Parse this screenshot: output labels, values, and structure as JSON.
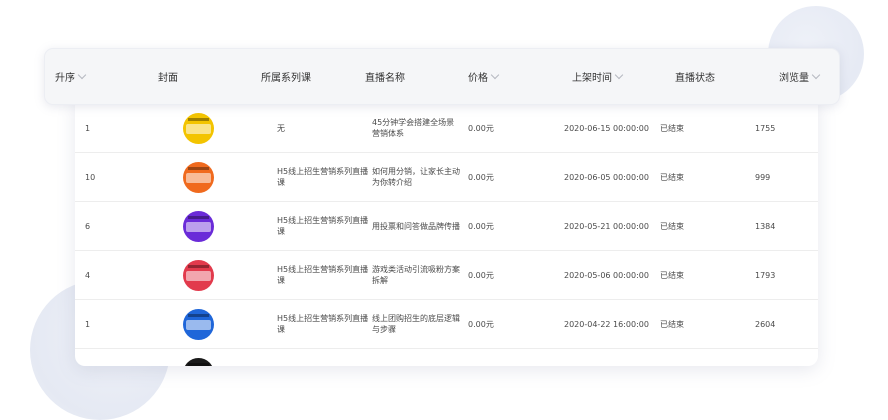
{
  "columns": {
    "seq": "升序",
    "cover": "封面",
    "series": "所属系列课",
    "name": "直播名称",
    "price": "价格",
    "time": "上架时间",
    "status": "直播状态",
    "views": "浏览量"
  },
  "rows": [
    {
      "seq": "1",
      "series": "无",
      "name": "45分钟学会搭建全场景营销体系",
      "price": "0.00元",
      "time": "2020-06-15 00:00:00",
      "status": "已结束",
      "views": "1755",
      "cover_color": "#f3c400"
    },
    {
      "seq": "10",
      "series": "H5线上招生营销系列直播课",
      "name": "如何用分销，让家长主动为你转介绍",
      "price": "0.00元",
      "time": "2020-06-05 00:00:00",
      "status": "已结束",
      "views": "999",
      "cover_color": "#f06a1e"
    },
    {
      "seq": "6",
      "series": "H5线上招生营销系列直播课",
      "name": "用投票和问答做品牌传播",
      "price": "0.00元",
      "time": "2020-05-21 00:00:00",
      "status": "已结束",
      "views": "1384",
      "cover_color": "#6a2bd8"
    },
    {
      "seq": "4",
      "series": "H5线上招生营销系列直播课",
      "name": "游戏类活动引流吸粉方案拆解",
      "price": "0.00元",
      "time": "2020-05-06 00:00:00",
      "status": "已结束",
      "views": "1793",
      "cover_color": "#e23a4c"
    },
    {
      "seq": "1",
      "series": "H5线上招生营销系列直播课",
      "name": "线上团购招生的底层逻辑与步骤",
      "price": "0.00元",
      "time": "2020-04-22 16:00:00",
      "status": "已结束",
      "views": "2604",
      "cover_color": "#1f66d9"
    },
    {
      "seq": "",
      "series": "",
      "name": "",
      "price": "",
      "time": "",
      "status": "",
      "views": "",
      "cover_color": "#1a1a1a"
    }
  ]
}
